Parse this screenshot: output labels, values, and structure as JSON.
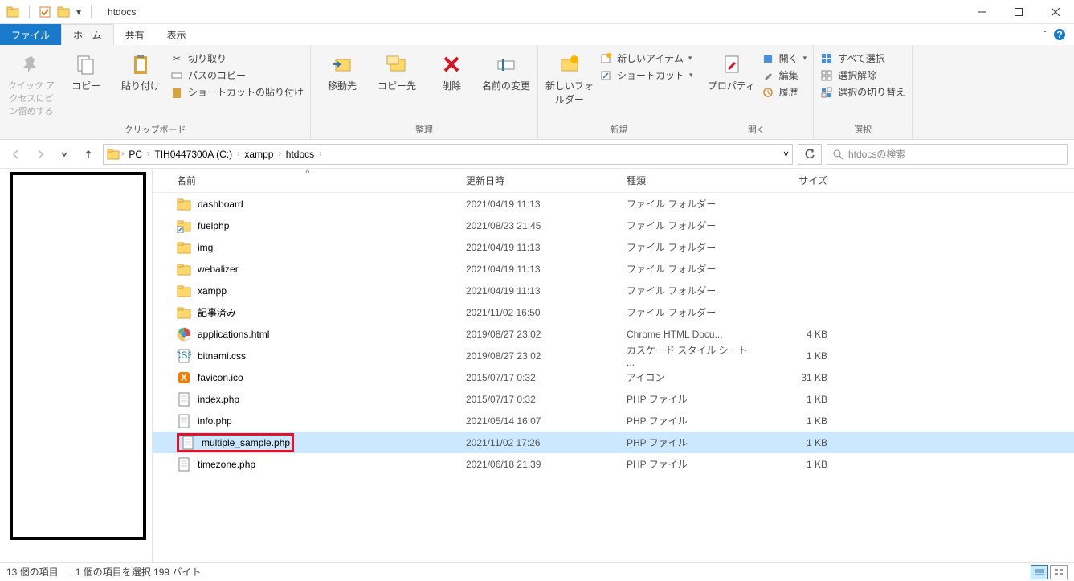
{
  "window": {
    "title": "htdocs"
  },
  "tabs": {
    "file": "ファイル",
    "home": "ホーム",
    "share": "共有",
    "view": "表示"
  },
  "ribbon": {
    "clipboard": {
      "label": "クリップボード",
      "pin": "クイック アクセスにピン留めする",
      "copy": "コピー",
      "paste": "貼り付け",
      "cut": "切り取り",
      "copypath": "パスのコピー",
      "pastesc": "ショートカットの貼り付け"
    },
    "organize": {
      "label": "整理",
      "moveto": "移動先",
      "copyto": "コピー先",
      "delete": "削除",
      "rename": "名前の変更"
    },
    "new": {
      "label": "新規",
      "newfolder": "新しいフォルダー",
      "newitem": "新しいアイテム",
      "shortcut": "ショートカット"
    },
    "open": {
      "label": "開く",
      "properties": "プロパティ",
      "open": "開く",
      "edit": "編集",
      "history": "履歴"
    },
    "select": {
      "label": "選択",
      "selectall": "すべて選択",
      "selectnone": "選択解除",
      "invert": "選択の切り替え"
    }
  },
  "breadcrumb": {
    "items": [
      "PC",
      "TIH0447300A (C:)",
      "xampp",
      "htdocs"
    ]
  },
  "search": {
    "placeholder": "htdocsの検索"
  },
  "columns": {
    "name": "名前",
    "date": "更新日時",
    "type": "種類",
    "size": "サイズ"
  },
  "files": [
    {
      "icon": "folder",
      "name": "dashboard",
      "date": "2021/04/19 11:13",
      "type": "ファイル フォルダー",
      "size": ""
    },
    {
      "icon": "shortcut",
      "name": "fuelphp",
      "date": "2021/08/23 21:45",
      "type": "ファイル フォルダー",
      "size": ""
    },
    {
      "icon": "folder",
      "name": "img",
      "date": "2021/04/19 11:13",
      "type": "ファイル フォルダー",
      "size": ""
    },
    {
      "icon": "folder",
      "name": "webalizer",
      "date": "2021/04/19 11:13",
      "type": "ファイル フォルダー",
      "size": ""
    },
    {
      "icon": "folder",
      "name": "xampp",
      "date": "2021/04/19 11:13",
      "type": "ファイル フォルダー",
      "size": ""
    },
    {
      "icon": "folder",
      "name": "記事済み",
      "date": "2021/11/02 16:50",
      "type": "ファイル フォルダー",
      "size": ""
    },
    {
      "icon": "chrome",
      "name": "applications.html",
      "date": "2019/08/27 23:02",
      "type": "Chrome HTML Docu...",
      "size": "4 KB"
    },
    {
      "icon": "css",
      "name": "bitnami.css",
      "date": "2019/08/27 23:02",
      "type": "カスケード スタイル シート ...",
      "size": "1 KB"
    },
    {
      "icon": "xampp",
      "name": "favicon.ico",
      "date": "2015/07/17 0:32",
      "type": "アイコン",
      "size": "31 KB"
    },
    {
      "icon": "file",
      "name": "index.php",
      "date": "2015/07/17 0:32",
      "type": "PHP ファイル",
      "size": "1 KB"
    },
    {
      "icon": "file",
      "name": "info.php",
      "date": "2021/05/14 16:07",
      "type": "PHP ファイル",
      "size": "1 KB"
    },
    {
      "icon": "file",
      "name": "multiple_sample.php",
      "date": "2021/11/02 17:26",
      "type": "PHP ファイル",
      "size": "1 KB",
      "selected": true,
      "highlighted": true
    },
    {
      "icon": "file",
      "name": "timezone.php",
      "date": "2021/06/18 21:39",
      "type": "PHP ファイル",
      "size": "1 KB"
    }
  ],
  "status": {
    "count": "13 個の項目",
    "selection": "1 個の項目を選択 199 バイト"
  }
}
